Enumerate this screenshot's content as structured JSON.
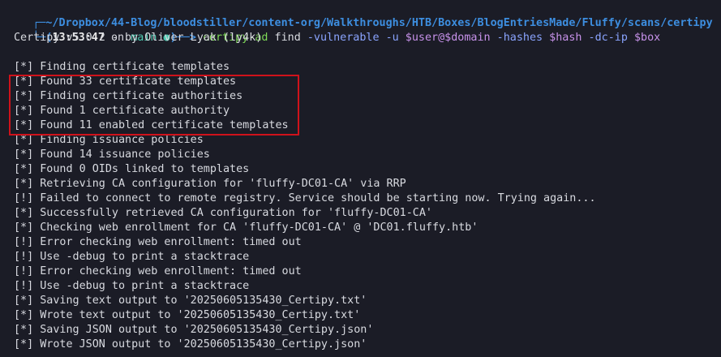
{
  "prompt": {
    "top_prefix": "┌─",
    "path": "~/Dropbox/44-Blog/bloodstiller/content-org/Walkthroughs/HTB/Boxes/BlogEntriesMade/Fluffy/scans/certipy",
    "bottom_prefix": "└─(",
    "time": "13:53:47",
    "on_word": " on ",
    "branch": "main",
    "branch_marker": " ●",
    "arrow": ")──> ",
    "command": "certipy-ad",
    "args": [
      {
        "text": " find",
        "kind": "plain"
      },
      {
        "text": " -vulnerable",
        "kind": "arg"
      },
      {
        "text": " -u",
        "kind": "arg"
      },
      {
        "text": " $user@$domain",
        "kind": "var"
      },
      {
        "text": " -hashes",
        "kind": "arg"
      },
      {
        "text": " $hash",
        "kind": "var"
      },
      {
        "text": " -dc-ip",
        "kind": "arg"
      },
      {
        "text": " $box",
        "kind": "var"
      }
    ]
  },
  "banner": "Certipy v5.0.2 - by Oliver Lyak (ly4k)",
  "output_lines": [
    "[*] Finding certificate templates",
    "[*] Found 33 certificate templates",
    "[*] Finding certificate authorities",
    "[*] Found 1 certificate authority",
    "[*] Found 11 enabled certificate templates",
    "[*] Finding issuance policies",
    "[*] Found 14 issuance policies",
    "[*] Found 0 OIDs linked to templates",
    "[*] Retrieving CA configuration for 'fluffy-DC01-CA' via RRP",
    "[!] Failed to connect to remote registry. Service should be starting now. Trying again...",
    "[*] Successfully retrieved CA configuration for 'fluffy-DC01-CA'",
    "[*] Checking web enrollment for CA 'fluffy-DC01-CA' @ 'DC01.fluffy.htb'",
    "[!] Error checking web enrollment: timed out",
    "[!] Use -debug to print a stacktrace",
    "[!] Error checking web enrollment: timed out",
    "[!] Use -debug to print a stacktrace",
    "[*] Saving text output to '20250605135430_Certipy.txt'",
    "[*] Wrote text output to '20250605135430_Certipy.txt'",
    "[*] Saving JSON output to '20250605135430_Certipy.json'",
    "[*] Wrote JSON output to '20250605135430_Certipy.json'"
  ],
  "colors": {
    "background": "#1b1c26",
    "text": "#d8dae0",
    "path": "#3d8ee0",
    "command": "#7ed957",
    "highlight_box": "#d0121b"
  }
}
